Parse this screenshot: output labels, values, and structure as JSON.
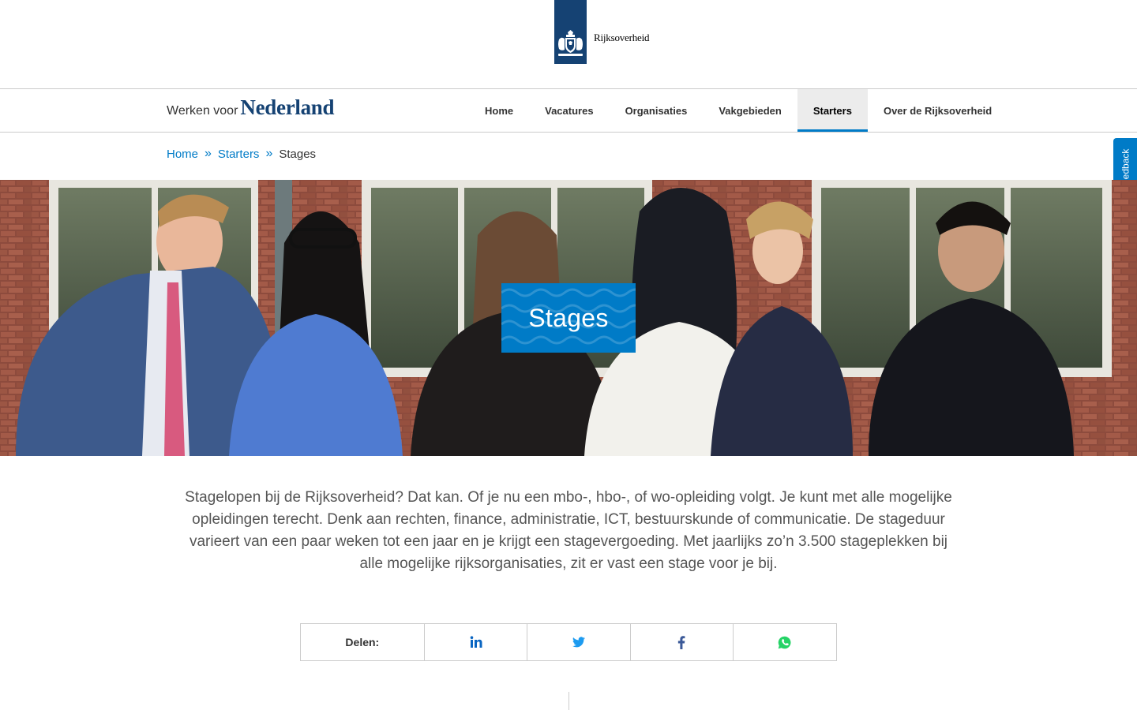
{
  "header": {
    "logo_text": "Rijksoverheid"
  },
  "brand": {
    "prefix": "Werken voor",
    "name": "Nederland"
  },
  "nav": {
    "items": [
      {
        "label": "Home"
      },
      {
        "label": "Vacatures"
      },
      {
        "label": "Organisaties"
      },
      {
        "label": "Vakgebieden"
      },
      {
        "label": "Starters"
      },
      {
        "label": "Over de Rijksoverheid"
      }
    ],
    "active": "Starters"
  },
  "breadcrumb": {
    "items": [
      "Home",
      "Starters"
    ],
    "current": "Stages",
    "separator": "»"
  },
  "feedback": {
    "label": "Feedback"
  },
  "hero": {
    "title": "Stages"
  },
  "intro": {
    "text": "Stagelopen bij de Rijksoverheid? Dat kan. Of je nu een mbo-, hbo-, of wo-opleiding volgt. Je kunt met alle mogelijke opleidingen terecht. Denk aan rechten, finance, administratie, ICT, bestuurskunde of communicatie. De stageduur varieert van een paar weken tot een jaar en je krijgt een stagevergoeding. Met jaarlijks zo’n 3.500 stageplekken bij alle mogelijke rijksorganisaties, zit er vast een stage voor je bij."
  },
  "share": {
    "label": "Delen:",
    "buttons": [
      {
        "icon": "linkedin-icon",
        "color": "#0a66c2"
      },
      {
        "icon": "twitter-icon",
        "color": "#1d9bf0"
      },
      {
        "icon": "facebook-icon",
        "color": "#3b5998"
      },
      {
        "icon": "whatsapp-icon",
        "color": "#25d366"
      }
    ]
  },
  "colors": {
    "brand_blue": "#154273",
    "accent_blue": "#007bc7",
    "text_gray": "#555555"
  }
}
